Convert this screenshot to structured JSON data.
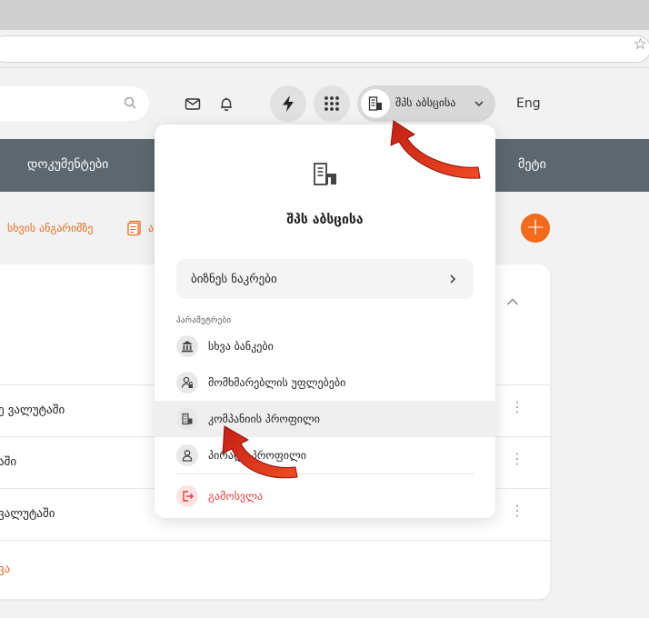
{
  "header": {
    "company_name": "შპს აბსცისა",
    "language": "Eng"
  },
  "nav": {
    "documents": "დოკუმენტები",
    "more": "მეტი"
  },
  "sub_actions": {
    "other_account": "სხვის ანგარიშზე",
    "partial_link": "ა"
  },
  "rows": [
    {
      "text": "ე ვალუტაში"
    },
    {
      "text": "აში"
    },
    {
      "text": "ვალუტაში"
    }
  ],
  "row_footer": "ვა",
  "dropdown": {
    "title": "შპს აბსცისა",
    "business_cards": "ბიზნეს ნაკრები",
    "section_label": "პარამეტრები",
    "items": [
      {
        "label": "სხვა ბანკები",
        "icon": "bank-icon"
      },
      {
        "label": "მომხმარებლის უფლებები",
        "icon": "lock-user-icon"
      },
      {
        "label": "კომპანიის პროფილი",
        "icon": "building-icon"
      },
      {
        "label": "პირადი პროფილი",
        "icon": "person-icon"
      }
    ],
    "logout": "გამოსვლა"
  },
  "colors": {
    "accent": "#ee6a1f",
    "nav_bg": "#5c6770",
    "danger": "#e33b3b",
    "arrow": "#d92b1c"
  }
}
